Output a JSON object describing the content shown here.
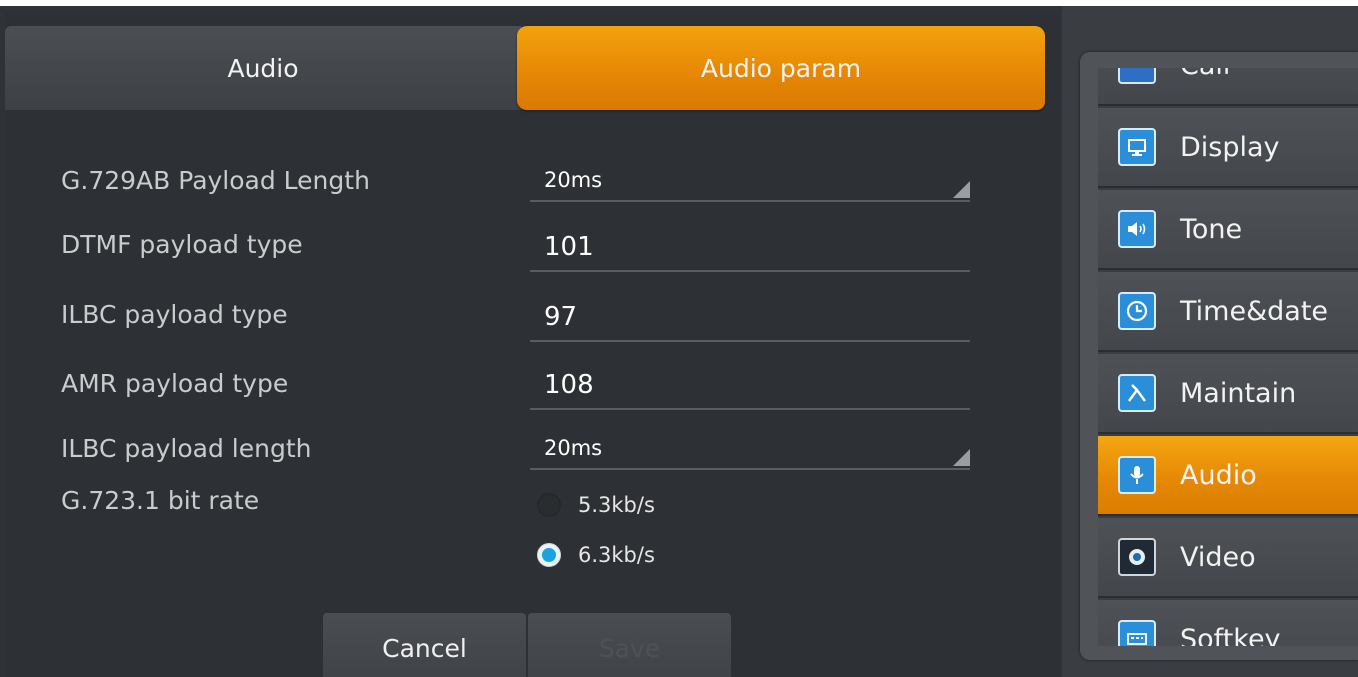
{
  "tabs": [
    {
      "label": "Audio",
      "active": false
    },
    {
      "label": "Audio param",
      "active": true
    }
  ],
  "form": {
    "g729_payload_length": {
      "label": "G.729AB Payload Length",
      "value": "20ms"
    },
    "dtmf_payload_type": {
      "label": "DTMF payload type",
      "value": "101"
    },
    "ilbc_payload_type": {
      "label": "ILBC payload type",
      "value": "97"
    },
    "amr_payload_type": {
      "label": "AMR payload type",
      "value": "108"
    },
    "ilbc_payload_length": {
      "label": "ILBC payload length",
      "value": "20ms"
    },
    "g7231_bit_rate": {
      "label": "G.723.1 bit rate",
      "options": [
        "5.3kb/s",
        "6.3kb/s"
      ],
      "selected": "6.3kb/s"
    }
  },
  "buttons": {
    "cancel": "Cancel",
    "save": "Save"
  },
  "sidebar": {
    "items": [
      {
        "label": "Call",
        "icon": "call-icon"
      },
      {
        "label": "Display",
        "icon": "monitor-icon"
      },
      {
        "label": "Tone",
        "icon": "speaker-icon"
      },
      {
        "label": "Time&date",
        "icon": "clock-icon"
      },
      {
        "label": "Maintain",
        "icon": "tools-icon"
      },
      {
        "label": "Audio",
        "icon": "microphone-icon",
        "active": true
      },
      {
        "label": "Video",
        "icon": "camera-icon"
      },
      {
        "label": "Softkey",
        "icon": "keyboard-icon"
      }
    ]
  },
  "colors": {
    "accent": "#e58605",
    "background": "#2f3236",
    "radio_selected": "#1aa3e0"
  }
}
